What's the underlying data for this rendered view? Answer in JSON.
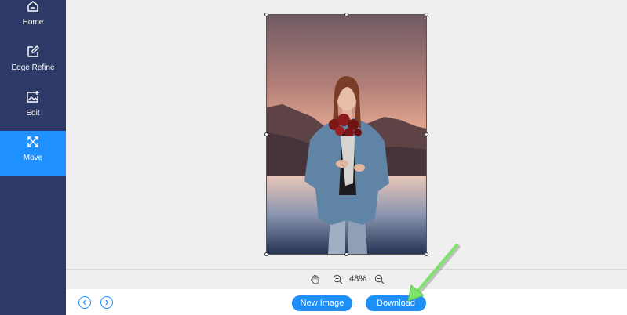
{
  "sidebar": {
    "items": [
      {
        "label": "Home",
        "icon": "home-icon"
      },
      {
        "label": "Edge Refine",
        "icon": "edit-square-icon"
      },
      {
        "label": "Edit",
        "icon": "image-plus-icon"
      },
      {
        "label": "Move",
        "icon": "move-arrows-icon",
        "active": true
      }
    ]
  },
  "zoom": {
    "level": "48%"
  },
  "toolbar": {
    "new_image_label": "New Image",
    "download_label": "Download"
  },
  "colors": {
    "sidebar": "#2d3a67",
    "active": "#1e90ff",
    "button": "#1e8ff6",
    "canvas": "#efefef",
    "annotation_arrow": "#7ee36a"
  }
}
